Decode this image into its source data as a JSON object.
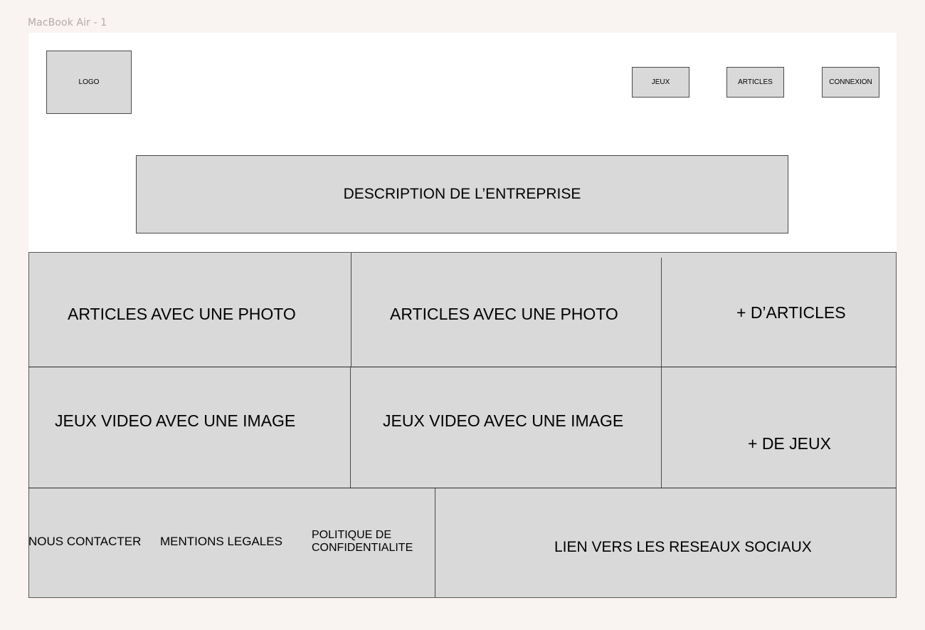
{
  "frame_label": "MacBook Air - 1",
  "header": {
    "logo": "LOGO",
    "nav": {
      "jeux": "JEUX",
      "articles": "ARTICLES",
      "connexion": "CONNEXION"
    }
  },
  "description": "DESCRIPTION DE L’ENTREPRISE",
  "articles_row": {
    "card_1": "ARTICLES AVEC UNE PHOTO",
    "card_2": "ARTICLES AVEC UNE PHOTO",
    "more": "+ D’ARTICLES"
  },
  "games_row": {
    "card_1": "JEUX VIDEO AVEC UNE IMAGE",
    "card_2": "JEUX VIDEO AVEC UNE IMAGE",
    "more": "+ DE JEUX"
  },
  "footer": {
    "contact": "NOUS CONTACTER",
    "legal": "MENTIONS LEGALES",
    "privacy_line1": "POLITIQUE DE",
    "privacy_line2": "CONFIDENTIALITE",
    "social": "LIEN VERS LES RESEAUX SOCIAUX"
  }
}
